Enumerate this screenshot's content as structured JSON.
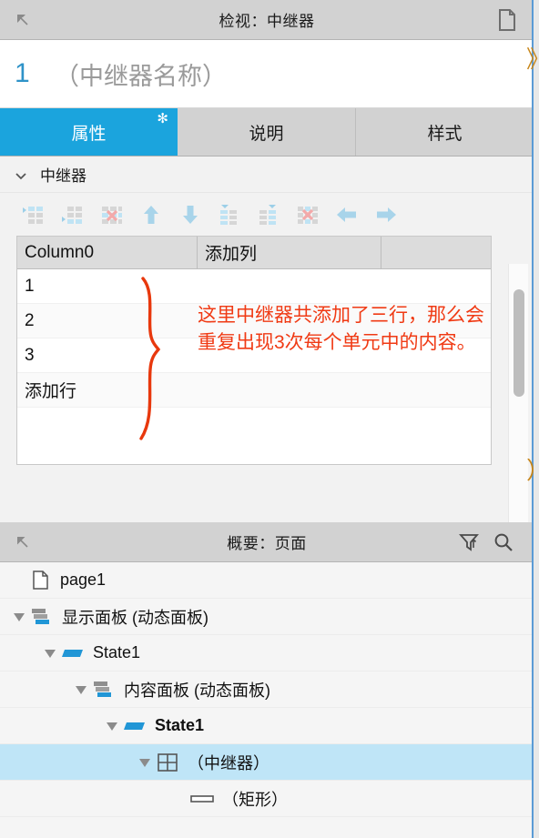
{
  "inspector": {
    "header": {
      "title": "检视：中继器",
      "left_icon": "arrow-northwest-icon",
      "right_icon": "page-document-icon"
    },
    "object_index": "1",
    "object_name": "（中继器名称）",
    "tabs": [
      {
        "label": "属性",
        "active": true,
        "modified_marker": "✻"
      },
      {
        "label": "说明",
        "active": false,
        "modified_marker": ""
      },
      {
        "label": "样式",
        "active": false,
        "modified_marker": ""
      }
    ],
    "section": {
      "label": "中继器",
      "expanded": true,
      "chevron": "chevron-down-icon"
    },
    "toolbar": [
      {
        "name": "insert-row-above-icon",
        "label": "在上方插入行"
      },
      {
        "name": "insert-row-below-icon",
        "label": "在下方插入行"
      },
      {
        "name": "delete-row-icon",
        "label": "删除行"
      },
      {
        "name": "move-row-up-icon",
        "label": "上移行"
      },
      {
        "name": "move-row-down-icon",
        "label": "下移行"
      },
      {
        "name": "insert-column-left-icon",
        "label": "在左侧插入列"
      },
      {
        "name": "insert-column-right-icon",
        "label": "在右侧插入列"
      },
      {
        "name": "delete-column-icon",
        "label": "删除列"
      },
      {
        "name": "move-column-left-icon",
        "label": "左移列"
      },
      {
        "name": "move-column-right-icon",
        "label": "右移列"
      }
    ],
    "table": {
      "columns": [
        "Column0",
        "添加列",
        ""
      ],
      "rows": [
        [
          "1",
          "",
          ""
        ],
        [
          "2",
          "",
          ""
        ],
        [
          "3",
          "",
          ""
        ],
        [
          "添加行",
          "",
          ""
        ]
      ]
    },
    "annotation": {
      "text": "这里中继器共添加了三行，那么会重复出现3次每个单元中的内容。",
      "color": "#f03a14",
      "brace": "hand-drawn-curly-brace"
    }
  },
  "outline": {
    "header": {
      "title": "概要：页面",
      "left_icon": "arrow-northwest-icon",
      "filter_icon": "filter-icon",
      "search_icon": "search-icon"
    },
    "tree": [
      {
        "label": "page1",
        "depth": 0,
        "icon": "page-document-icon",
        "arrow": "",
        "selected": false,
        "bold": false
      },
      {
        "label": "显示面板 (动态面板)",
        "depth": 1,
        "icon": "dynamic-panel-icon",
        "arrow": "triangle-down-icon",
        "selected": false,
        "bold": false
      },
      {
        "label": "State1",
        "depth": 2,
        "icon": "panel-state-icon",
        "arrow": "triangle-down-icon",
        "selected": false,
        "bold": false
      },
      {
        "label": "内容面板 (动态面板)",
        "depth": 3,
        "icon": "dynamic-panel-icon",
        "arrow": "triangle-down-icon",
        "selected": false,
        "bold": false
      },
      {
        "label": "State1",
        "depth": 4,
        "icon": "panel-state-icon",
        "arrow": "triangle-down-icon",
        "selected": false,
        "bold": true
      },
      {
        "label": "（中继器）",
        "depth": 5,
        "icon": "repeater-grid-icon",
        "arrow": "triangle-down-icon",
        "selected": true,
        "bold": false
      },
      {
        "label": "（矩形）",
        "depth": 6,
        "icon": "rectangle-icon",
        "arrow": "",
        "selected": false,
        "bold": false
      }
    ]
  },
  "colors": {
    "accent": "#1ba4dd",
    "selection": "#bfe5f7",
    "annotation": "#f03a14",
    "panel_header": "#d2d2d2",
    "tree_bg": "#f5f5f5"
  }
}
